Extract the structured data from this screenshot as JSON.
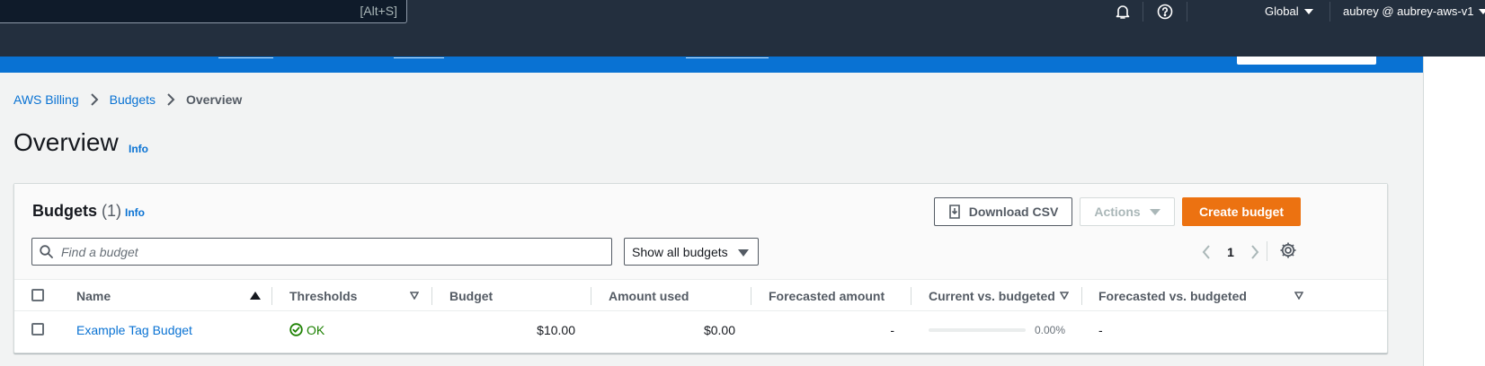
{
  "topnav": {
    "search_shortcut": "[Alt+S]",
    "region_label": "Global",
    "account_label": "aubrey @ aubrey-aws-v1",
    "icons": [
      "bell-icon",
      "help-icon"
    ]
  },
  "breadcrumb": {
    "items": [
      "AWS Billing",
      "Budgets"
    ],
    "current": "Overview"
  },
  "page": {
    "title": "Overview",
    "info": "Info"
  },
  "budgets_panel": {
    "title": "Budgets",
    "count": "(1)",
    "info": "Info",
    "download_label": "Download CSV",
    "actions_label": "Actions",
    "create_label": "Create budget",
    "search_placeholder": "Find a budget",
    "filter_value": "Show all budgets",
    "page_number": "1"
  },
  "table": {
    "columns": [
      "Name",
      "Thresholds",
      "Budget",
      "Amount used",
      "Forecasted amount",
      "Current vs. budgeted",
      "Forecasted vs. budgeted"
    ],
    "rows": [
      {
        "name": "Example Tag Budget",
        "thresholds": "OK",
        "budget": "$10.00",
        "amount_used": "$0.00",
        "forecasted_amount": "-",
        "current_vs_budgeted": "0.00%",
        "current_vs_budgeted_fraction": 0,
        "forecasted_vs_budgeted": "-"
      }
    ]
  },
  "colors": {
    "nav_bg": "#232f3e",
    "banner": "#0972d3",
    "primary_button": "#ec7211",
    "link": "#0972d3",
    "ok": "#1d8102"
  }
}
